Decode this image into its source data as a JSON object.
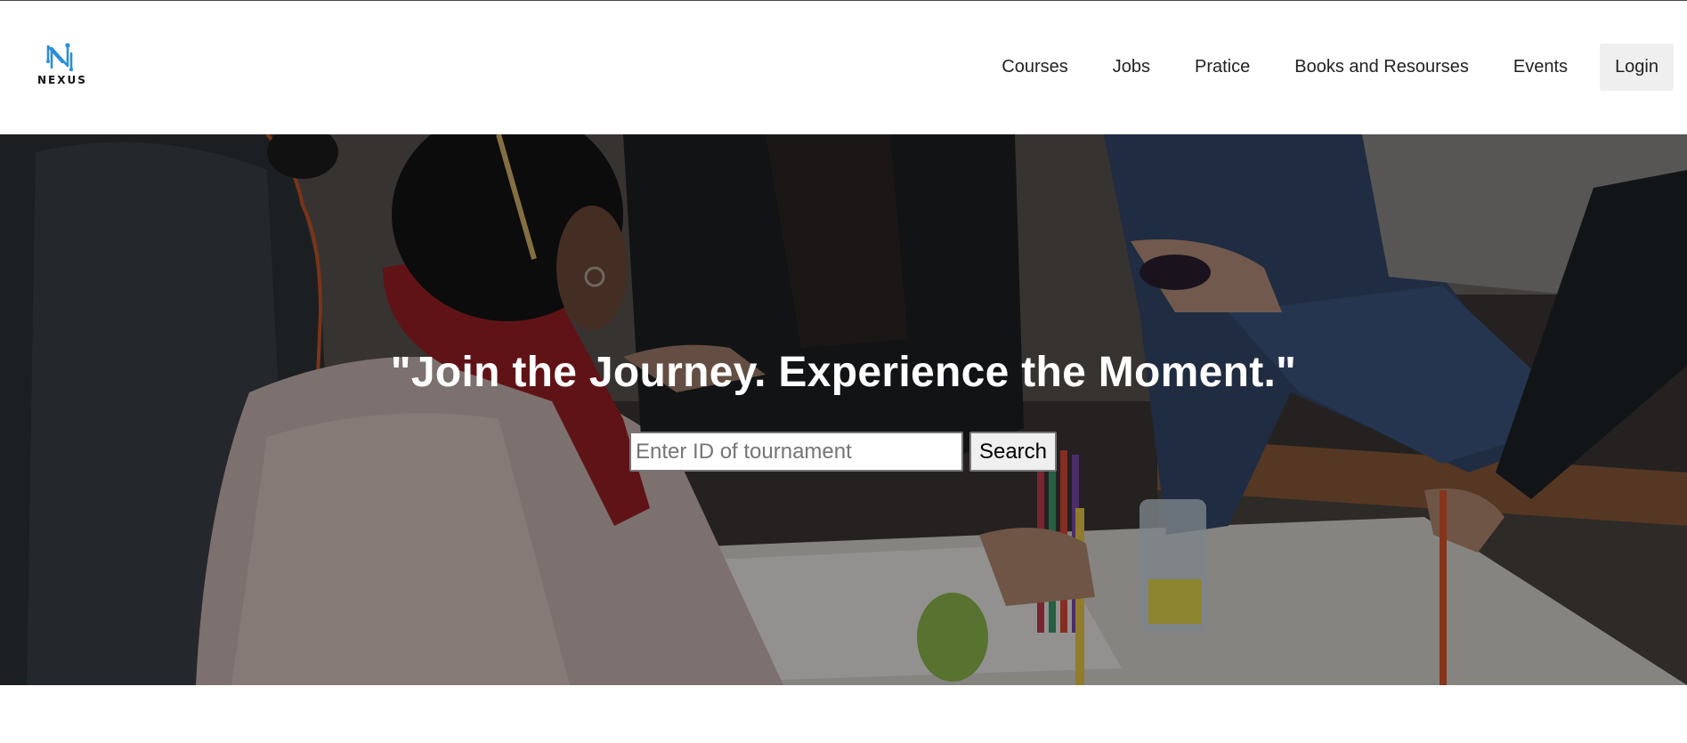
{
  "brand": {
    "logo_icon": "nexus-n-logo-icon",
    "logo_text": "NEXUS",
    "accent": "#2b8fd6"
  },
  "nav": {
    "items": [
      {
        "label": "Courses"
      },
      {
        "label": "Jobs"
      },
      {
        "label": "Pratice"
      },
      {
        "label": "Books and Resourses"
      },
      {
        "label": "Events"
      }
    ],
    "login_label": "Login"
  },
  "hero": {
    "title": "\"Join the Journey. Experience the Moment.\"",
    "search": {
      "placeholder": "Enter ID of tournament",
      "value": "",
      "button_label": "Search"
    }
  }
}
